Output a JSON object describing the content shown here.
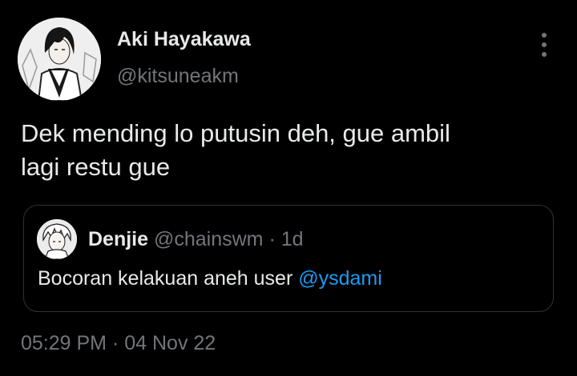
{
  "tweet": {
    "author": {
      "display_name": "Aki Hayakawa",
      "handle": "@kitsuneakm",
      "avatar_icon": "anime-character-avatar"
    },
    "more_icon": "more-options-icon",
    "text": {
      "line1": "Dek mending lo putusin deh, gue ambil",
      "line2": "lagi restu gue"
    },
    "quoted": {
      "display_name": "Denjie",
      "handle": "@chainswm",
      "separator": "·",
      "time": "1d",
      "text_prefix": "Bocoran kelakuan aneh user ",
      "mention": "@ysdami",
      "avatar_icon": "anime-character-avatar"
    },
    "timestamp": {
      "time": "05:29 PM",
      "separator": "·",
      "date": "04 Nov 22"
    }
  },
  "colors": {
    "background": "#000000",
    "primary_text": "#e7e9ea",
    "secondary_text": "#71767b",
    "link": "#1d9bf0",
    "border": "#2f3336"
  }
}
